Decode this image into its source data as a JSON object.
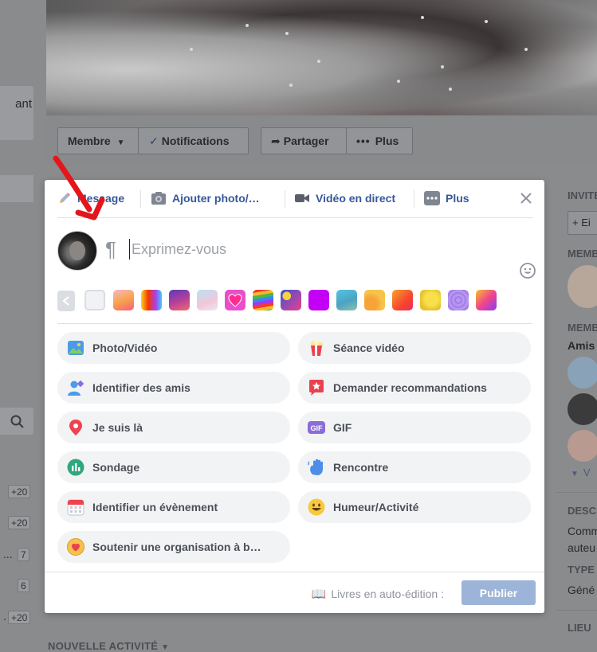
{
  "background": {
    "left_card_text": "ant",
    "nav": {
      "member": "Membre",
      "notifications": "Notifications",
      "share": "Partager",
      "more": "Plus"
    },
    "left_counts": [
      {
        "value": "+20"
      },
      {
        "value": "+20"
      },
      {
        "value": "7",
        "lead": "..."
      },
      {
        "value": "6"
      },
      {
        "value": "+20",
        "lead": "."
      }
    ],
    "sidebar": {
      "invite_header": "INVITE",
      "invite_button": "+ Ei",
      "members_header_1": "MEMB",
      "members_header_2": "MEMB",
      "friends_label": "Amis",
      "see_more": "V",
      "description_header": "DESC",
      "description_lines": [
        "Comm",
        "auteu"
      ],
      "type_header": "TYPE",
      "type_value": "Géné",
      "location_header": "LIEU"
    },
    "activity_header": "NOUVELLE ACTIVITÉ"
  },
  "composer": {
    "tabs": [
      {
        "label": "Message",
        "icon": "pencil-icon"
      },
      {
        "label": "Ajouter photo/…",
        "icon": "camera-icon"
      },
      {
        "label": "Vidéo en direct",
        "icon": "video-camera-icon"
      },
      {
        "label": "Plus",
        "icon": "more-dots-icon"
      }
    ],
    "input_placeholder": "Exprimez-vous",
    "actions": [
      {
        "label": "Photo/Vidéo",
        "icon": "photo-icon"
      },
      {
        "label": "Séance vidéo",
        "icon": "popcorn-icon"
      },
      {
        "label": "Identifier des amis",
        "icon": "tag-friends-icon"
      },
      {
        "label": "Demander recommandations",
        "icon": "recommendation-icon"
      },
      {
        "label": "Je suis là",
        "icon": "location-pin-icon"
      },
      {
        "label": "GIF",
        "icon": "gif-icon"
      },
      {
        "label": "Sondage",
        "icon": "poll-icon"
      },
      {
        "label": "Rencontre",
        "icon": "wave-hand-icon"
      },
      {
        "label": "Identifier un évènement",
        "icon": "calendar-icon"
      },
      {
        "label": "Humeur/Activité",
        "icon": "smiley-icon"
      },
      {
        "label": "Soutenir une organisation à b…",
        "icon": "donate-heart-icon"
      }
    ],
    "privacy_label": "Livres en auto-édition :",
    "publish_label": "Publier"
  },
  "colors": {
    "link_blue": "#365899",
    "publish_disabled": "#9cb4d8",
    "pill_bg": "#f2f3f5",
    "annotation_red": "#e4161b"
  }
}
